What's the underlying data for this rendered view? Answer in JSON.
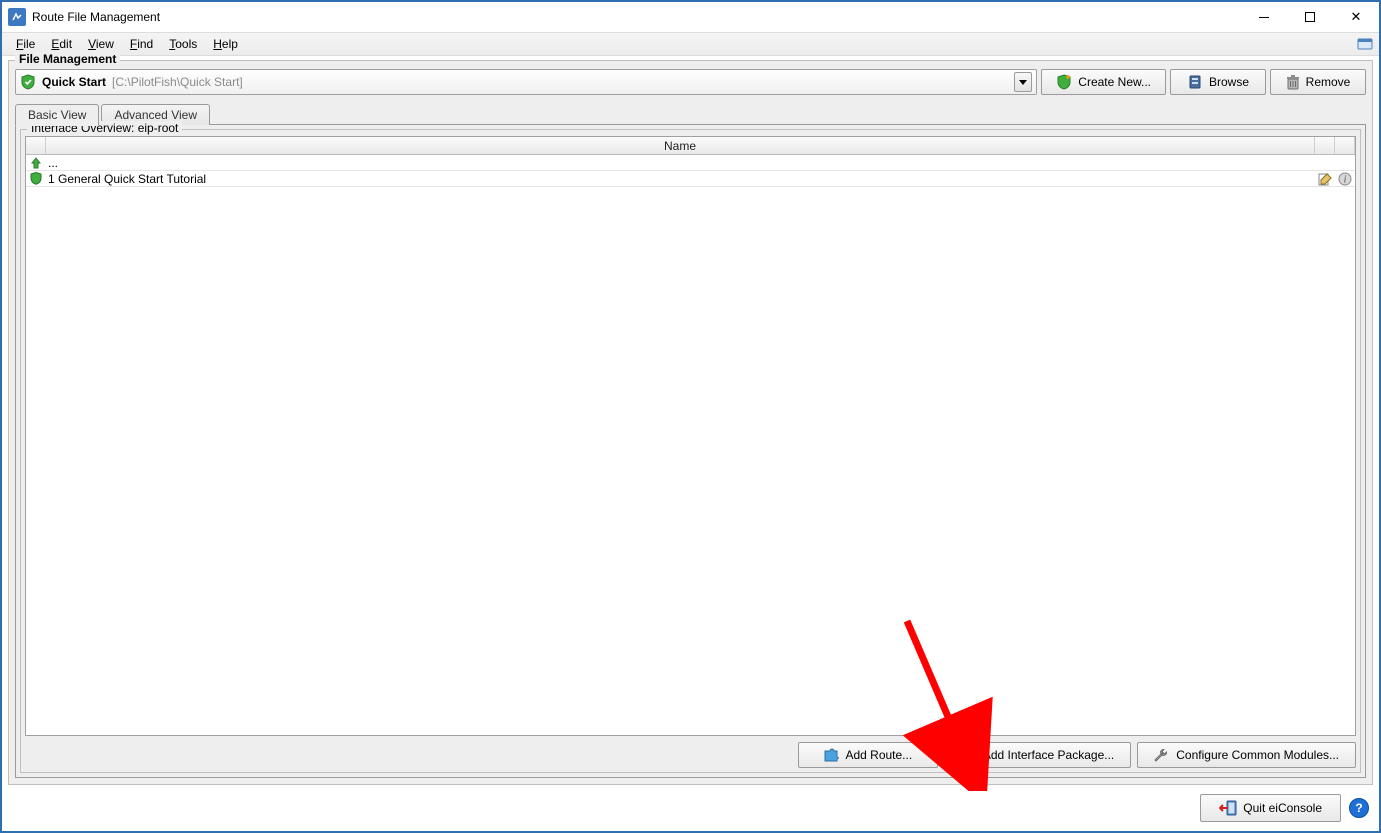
{
  "window": {
    "title": "Route File Management"
  },
  "menubar": {
    "file": "File",
    "edit": "Edit",
    "view": "View",
    "find": "Find",
    "tools": "Tools",
    "help": "Help"
  },
  "fm": {
    "legend": "File Management",
    "path_name": "Quick Start",
    "path_dir": "[C:\\PilotFish\\Quick Start]",
    "create_new": "Create New...",
    "browse": "Browse",
    "remove": "Remove",
    "tab_basic": "Basic View",
    "tab_advanced": "Advanced View",
    "overview_legend": "Interface Overview: eip-root",
    "col_name": "Name",
    "row_up": "...",
    "row_tutorial": "1 General Quick Start Tutorial",
    "add_route": "Add Route...",
    "add_pkg": "Add Interface Package...",
    "cfg_modules": "Configure Common Modules..."
  },
  "footer": {
    "quit": "Quit eiConsole"
  }
}
